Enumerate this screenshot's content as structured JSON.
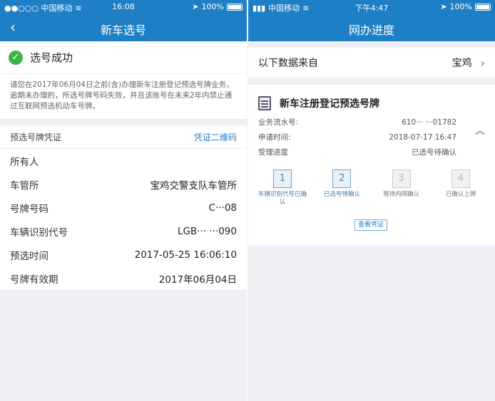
{
  "left": {
    "status": {
      "carrier": "●●○○○ 中国移动",
      "time": "16:08",
      "battery": "100%"
    },
    "nav": {
      "back_label": "‹",
      "title": "新车选号"
    },
    "success": {
      "text": "选号成功"
    },
    "notice": "请您在2017年06月04日之前(含)办理新车注册登记预选号牌业务，逾期未办理的，所选号牌号码失效，并且该账号在未来2年内禁止通过互联网预选机动车号牌。",
    "voucher": {
      "label": "预选号牌凭证",
      "link": "凭证二维码"
    },
    "rows": [
      {
        "label": "所有人",
        "value": ""
      },
      {
        "label": "车管所",
        "value": "宝鸡交警支队车管所"
      },
      {
        "label": "号牌号码",
        "value": "C···08"
      },
      {
        "label": "车辆识别代号",
        "value": "LGB··· ···090"
      },
      {
        "label": "预选时间",
        "value": "2017-05-25 16:06:10"
      },
      {
        "label": "号牌有效期",
        "value": "2017年06月04日"
      }
    ]
  },
  "right": {
    "status": {
      "carrier": "中国移动",
      "time": "下午4:47",
      "battery": "100%"
    },
    "nav": {
      "title": "网办进度"
    },
    "source": {
      "label": "以下数据来自",
      "value": "宝鸡"
    },
    "card": {
      "title": "新车注册登记预选号牌",
      "info": [
        {
          "label": "业务流水号:",
          "value": "610···  ···01782"
        },
        {
          "label": "申请时间:",
          "value": "2018-07-17 16:47"
        },
        {
          "label": "受理进度",
          "value": "已选号待确认"
        }
      ],
      "steps": [
        {
          "num": "1",
          "label": "车辆识别代号已确认"
        },
        {
          "num": "2",
          "label": "已选号待确认"
        },
        {
          "num": "3",
          "label": "等待内网确认"
        },
        {
          "num": "4",
          "label": "已确认上牌"
        }
      ],
      "view_button": "查看凭证"
    }
  }
}
